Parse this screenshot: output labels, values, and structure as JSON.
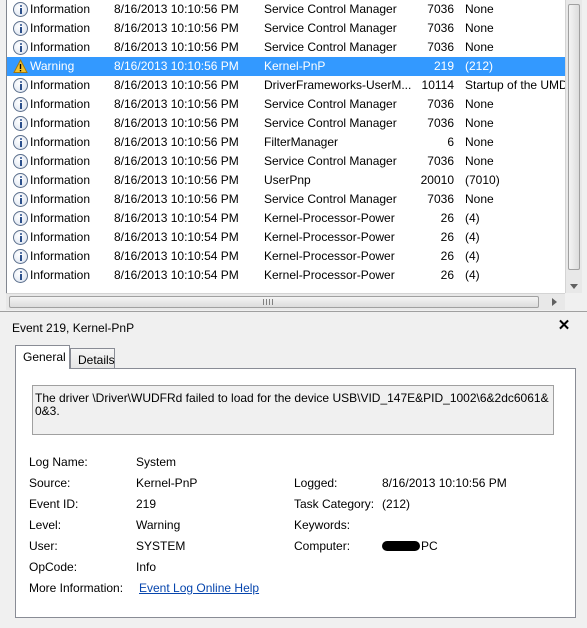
{
  "events": [
    {
      "level": "Information",
      "icon": "info-icon",
      "date": "8/16/2013 10:10:56 PM",
      "source": "Service Control Manager",
      "event_id": "7036",
      "task": "None",
      "selected": false
    },
    {
      "level": "Information",
      "icon": "info-icon",
      "date": "8/16/2013 10:10:56 PM",
      "source": "Service Control Manager",
      "event_id": "7036",
      "task": "None",
      "selected": false
    },
    {
      "level": "Information",
      "icon": "info-icon",
      "date": "8/16/2013 10:10:56 PM",
      "source": "Service Control Manager",
      "event_id": "7036",
      "task": "None",
      "selected": false
    },
    {
      "level": "Warning",
      "icon": "warning-icon",
      "date": "8/16/2013 10:10:56 PM",
      "source": "Kernel-PnP",
      "event_id": "219",
      "task": "(212)",
      "selected": true
    },
    {
      "level": "Information",
      "icon": "info-icon",
      "date": "8/16/2013 10:10:56 PM",
      "source": "DriverFrameworks-UserM...",
      "event_id": "10114",
      "task": "Startup of the UMD",
      "selected": false
    },
    {
      "level": "Information",
      "icon": "info-icon",
      "date": "8/16/2013 10:10:56 PM",
      "source": "Service Control Manager",
      "event_id": "7036",
      "task": "None",
      "selected": false
    },
    {
      "level": "Information",
      "icon": "info-icon",
      "date": "8/16/2013 10:10:56 PM",
      "source": "Service Control Manager",
      "event_id": "7036",
      "task": "None",
      "selected": false
    },
    {
      "level": "Information",
      "icon": "info-icon",
      "date": "8/16/2013 10:10:56 PM",
      "source": "FilterManager",
      "event_id": "6",
      "task": "None",
      "selected": false
    },
    {
      "level": "Information",
      "icon": "info-icon",
      "date": "8/16/2013 10:10:56 PM",
      "source": "Service Control Manager",
      "event_id": "7036",
      "task": "None",
      "selected": false
    },
    {
      "level": "Information",
      "icon": "info-icon",
      "date": "8/16/2013 10:10:56 PM",
      "source": "UserPnp",
      "event_id": "20010",
      "task": "(7010)",
      "selected": false
    },
    {
      "level": "Information",
      "icon": "info-icon",
      "date": "8/16/2013 10:10:56 PM",
      "source": "Service Control Manager",
      "event_id": "7036",
      "task": "None",
      "selected": false
    },
    {
      "level": "Information",
      "icon": "info-icon",
      "date": "8/16/2013 10:10:54 PM",
      "source": "Kernel-Processor-Power",
      "event_id": "26",
      "task": "(4)",
      "selected": false
    },
    {
      "level": "Information",
      "icon": "info-icon",
      "date": "8/16/2013 10:10:54 PM",
      "source": "Kernel-Processor-Power",
      "event_id": "26",
      "task": "(4)",
      "selected": false
    },
    {
      "level": "Information",
      "icon": "info-icon",
      "date": "8/16/2013 10:10:54 PM",
      "source": "Kernel-Processor-Power",
      "event_id": "26",
      "task": "(4)",
      "selected": false
    },
    {
      "level": "Information",
      "icon": "info-icon",
      "date": "8/16/2013 10:10:54 PM",
      "source": "Kernel-Processor-Power",
      "event_id": "26",
      "task": "(4)",
      "selected": false
    }
  ],
  "details": {
    "title": "Event 219, Kernel-PnP",
    "close_icon": "close-icon",
    "tabs": [
      "General",
      "Details"
    ],
    "active_tab": "General",
    "description": "The driver \\Driver\\WUDFRd failed to load for the device USB\\VID_147E&PID_1002\\6&2dc6061&0&3.",
    "log_name_label": "Log Name:",
    "log_name": "System",
    "source_label": "Source:",
    "source": "Kernel-PnP",
    "logged_label": "Logged:",
    "logged": "8/16/2013 10:10:56 PM",
    "event_id_label": "Event ID:",
    "event_id": "219",
    "task_category_label": "Task Category:",
    "task_category": "(212)",
    "level_label": "Level:",
    "level": "Warning",
    "keywords_label": "Keywords:",
    "keywords": "",
    "user_label": "User:",
    "user": "SYSTEM",
    "computer_label": "Computer:",
    "computer_suffix": "PC",
    "opcode_label": "OpCode:",
    "opcode": "Info",
    "more_info_label": "More Information:",
    "more_info_link": "Event Log Online Help"
  },
  "colors": {
    "selection": "#3399ff",
    "link": "#0645ad",
    "warning_triangle": "#f2c12e"
  }
}
